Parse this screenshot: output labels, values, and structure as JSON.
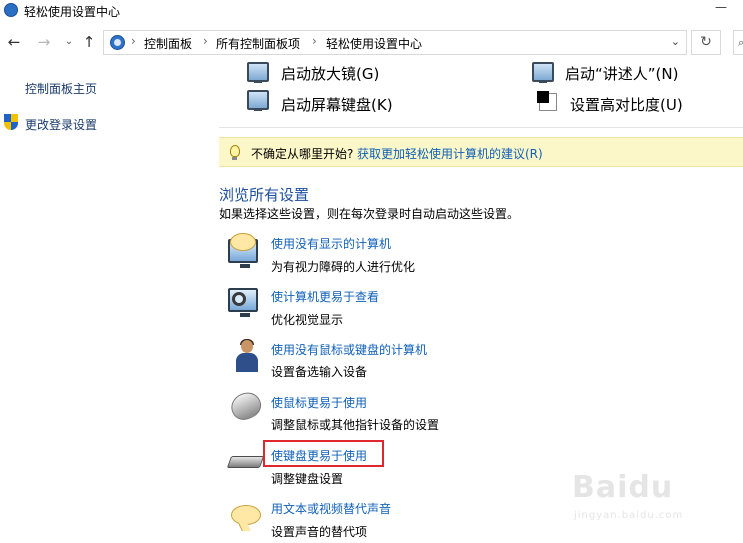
{
  "window": {
    "title": "轻松使用设置中心",
    "minimize_glyph": "—"
  },
  "navbar": {
    "back_glyph": "←",
    "forward_glyph": "→",
    "recent_glyph": "⌄",
    "up_glyph": "↑",
    "breadcrumb": [
      "控制面板",
      "所有控制面板项",
      "轻松使用设置中心"
    ],
    "separator": "›",
    "dropdown_glyph": "⌄",
    "refresh_glyph": "↻",
    "search_glyph": "⌕"
  },
  "sidebar": {
    "home": "控制面板主页",
    "change_login": "更改登录设置"
  },
  "quick_tools": {
    "magnifier": "启动放大镜(G)",
    "narrator": "启动“讲述人”(N)",
    "osk": "启动屏幕键盘(K)",
    "contrast": "设置高对比度(U)"
  },
  "tip": {
    "prefix": "不确定从哪里开始?",
    "link": "获取更加轻松使用计算机的建议(R)"
  },
  "browse": {
    "title": "浏览所有设置",
    "description": "如果选择这些设置，则在每次登录时自动启动这些设置。",
    "items": [
      {
        "link": "使用没有显示的计算机",
        "desc": "为有视力障碍的人进行优化",
        "icon": "monitor-speech-icon"
      },
      {
        "link": "使计算机更易于查看",
        "desc": "优化视觉显示",
        "icon": "monitor-magnifier-icon"
      },
      {
        "link": "使用没有鼠标或键盘的计算机",
        "desc": "设置备选输入设备",
        "icon": "person-icon"
      },
      {
        "link": "使鼠标更易于使用",
        "desc": "调整鼠标或其他指针设备的设置",
        "icon": "mouse-icon"
      },
      {
        "link": "使键盘更易于使用",
        "desc": "调整键盘设置",
        "icon": "keyboard-icon"
      },
      {
        "link": "用文本或视频替代声音",
        "desc": "设置声音的替代项",
        "icon": "speech-bubble-icon"
      }
    ]
  },
  "watermark": {
    "text": "Baidu",
    "sub": "jingyan.baidu.com"
  }
}
